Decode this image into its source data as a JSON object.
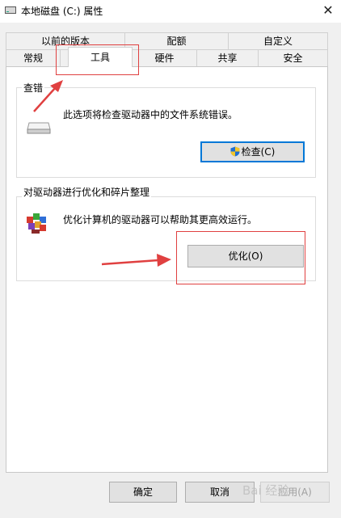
{
  "window": {
    "title": "本地磁盘 (C:) 属性",
    "close_glyph": "✕"
  },
  "tabs_row1": [
    {
      "label": "以前的版本"
    },
    {
      "label": "配额"
    },
    {
      "label": "自定义"
    }
  ],
  "tabs_row2": [
    {
      "label": "常规"
    },
    {
      "label": "工具",
      "active": true
    },
    {
      "label": "硬件"
    },
    {
      "label": "共享"
    },
    {
      "label": "安全"
    }
  ],
  "check_group": {
    "title": "查错",
    "description": "此选项将检查驱动器中的文件系统错误。",
    "button_label": "检查(C)",
    "icon": "drive-icon",
    "button_icon": "uac-shield-icon"
  },
  "optimize_group": {
    "title": "对驱动器进行优化和碎片整理",
    "description": "优化计算机的驱动器可以帮助其更高效运行。",
    "button_label": "优化(O)",
    "icon": "defrag-icon"
  },
  "footer": {
    "ok_label": "确定",
    "cancel_label": "取消",
    "apply_label": "应用(A)"
  },
  "watermark": {
    "text": "Bai 经验"
  },
  "colors": {
    "annotation_red": "#e04040",
    "focus_blue": "#0078d7",
    "dialog_bg": "#f0f0f0"
  }
}
